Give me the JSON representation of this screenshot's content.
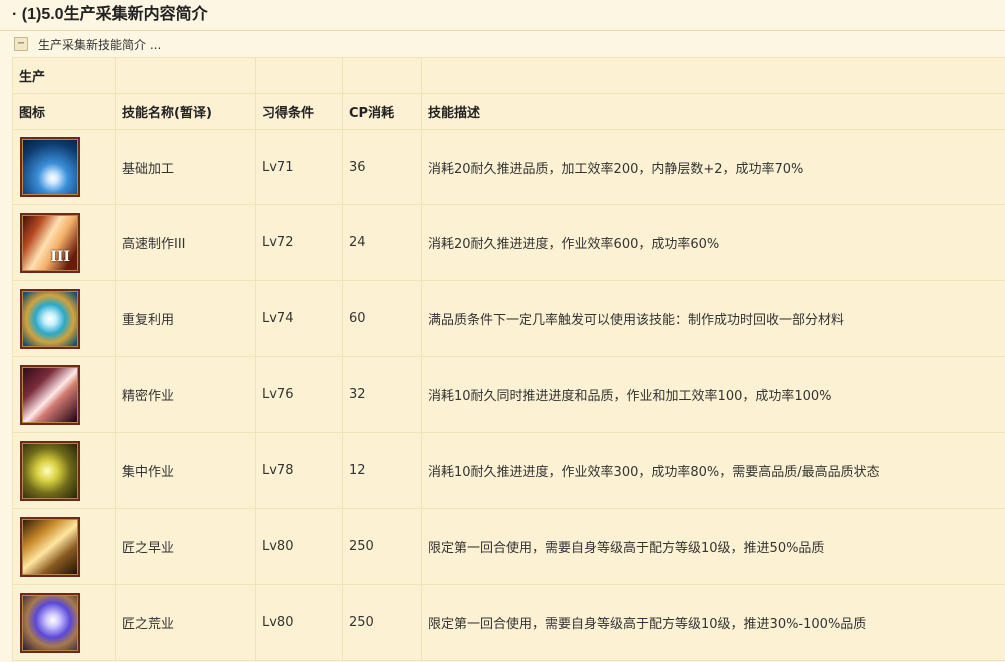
{
  "section": {
    "title": "· (1)5.0生产采集新内容简介",
    "collapse_symbol": "−",
    "collapse_label": "生产采集新技能简介 ..."
  },
  "table": {
    "group_label": "生产",
    "headers": [
      "图标",
      "技能名称(暂译)",
      "习得条件",
      "CP消耗",
      "技能描述"
    ],
    "rows": [
      {
        "icon": "basic-touch-skill-icon",
        "name": "基础加工",
        "level": "Lv71",
        "cp": "36",
        "desc": "消耗20耐久推进品质，加工效率200，内静层数+2，成功率70%"
      },
      {
        "icon": "rapid-synthesis-iii-skill-icon",
        "icon_text": "III",
        "name": "高速制作III",
        "level": "Lv72",
        "cp": "24",
        "desc": "消耗20耐久推进进度，作业效率600，成功率60%"
      },
      {
        "icon": "reuse-skill-icon",
        "name": "重复利用",
        "level": "Lv74",
        "cp": "60",
        "desc": "满品质条件下一定几率触发可以使用该技能：制作成功时回收一部分材料"
      },
      {
        "icon": "precise-touch-skill-icon",
        "name": "精密作业",
        "level": "Lv76",
        "cp": "32",
        "desc": "消耗10耐久同时推进进度和品质，作业和加工效率100，成功率100%"
      },
      {
        "icon": "focused-synthesis-skill-icon",
        "name": "集中作业",
        "level": "Lv78",
        "cp": "12",
        "desc": "消耗10耐久推进进度，作业效率300，成功率80%，需要高品质/最高品质状态"
      },
      {
        "icon": "masters-mend-early-skill-icon",
        "name": "匠之早业",
        "level": "Lv80",
        "cp": "250",
        "desc": "限定第一回合使用，需要自身等级高于配方等级10级，推进50%品质"
      },
      {
        "icon": "masters-mend-wild-skill-icon",
        "name": "匠之荒业",
        "level": "Lv80",
        "cp": "250",
        "desc": "限定第一回合使用，需要自身等级高于配方等级10级，推进30%-100%品质"
      }
    ]
  }
}
